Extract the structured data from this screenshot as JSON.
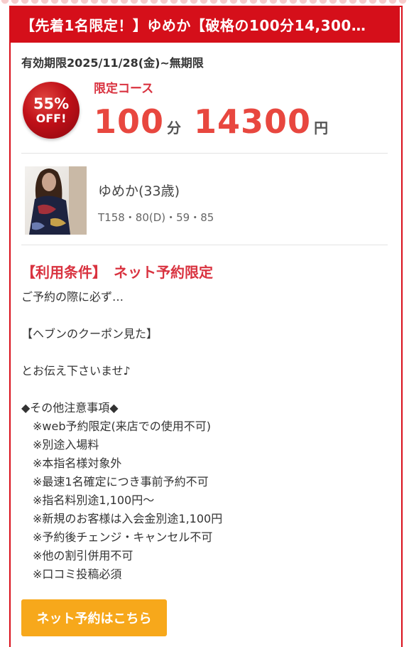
{
  "coupon": {
    "title": "【先着1名限定！】ゆめか【破格の100分14,300…",
    "validity": "有効期限2025/11/28(金)~無期限",
    "badge": {
      "percent": "55%",
      "off": "OFF!"
    },
    "course_label": "限定コース",
    "duration": "100",
    "duration_unit": "分",
    "price": "14300",
    "price_unit": "円",
    "colors": {
      "accent": "#d50f1a",
      "price": "#e8473f",
      "button": "#f7a81b"
    }
  },
  "cast": {
    "name": "ゆめか(33歳)",
    "spec": "T158・80(D)・59・85"
  },
  "conditions": {
    "heading": "【利用条件】　ネット予約限定",
    "lines": [
      "ご予約の際に必ず…",
      "",
      "【ヘブンのクーポン見た】",
      "",
      "とお伝え下さいませ♪",
      "",
      "◆その他注意事項◆"
    ],
    "notes": [
      "※web予約限定(来店での使用不可)",
      "※別途入場料",
      "※本指名様対象外",
      "※最速1名確定につき事前予約不可",
      "※指名料別途1,100円〜",
      "※新規のお客様は入会金別途1,100円",
      "※予約後チェンジ・キャンセル不可",
      "※他の割引併用不可",
      "※口コミ投稿必須"
    ]
  },
  "button": {
    "label": "ネット予約はこちら"
  }
}
